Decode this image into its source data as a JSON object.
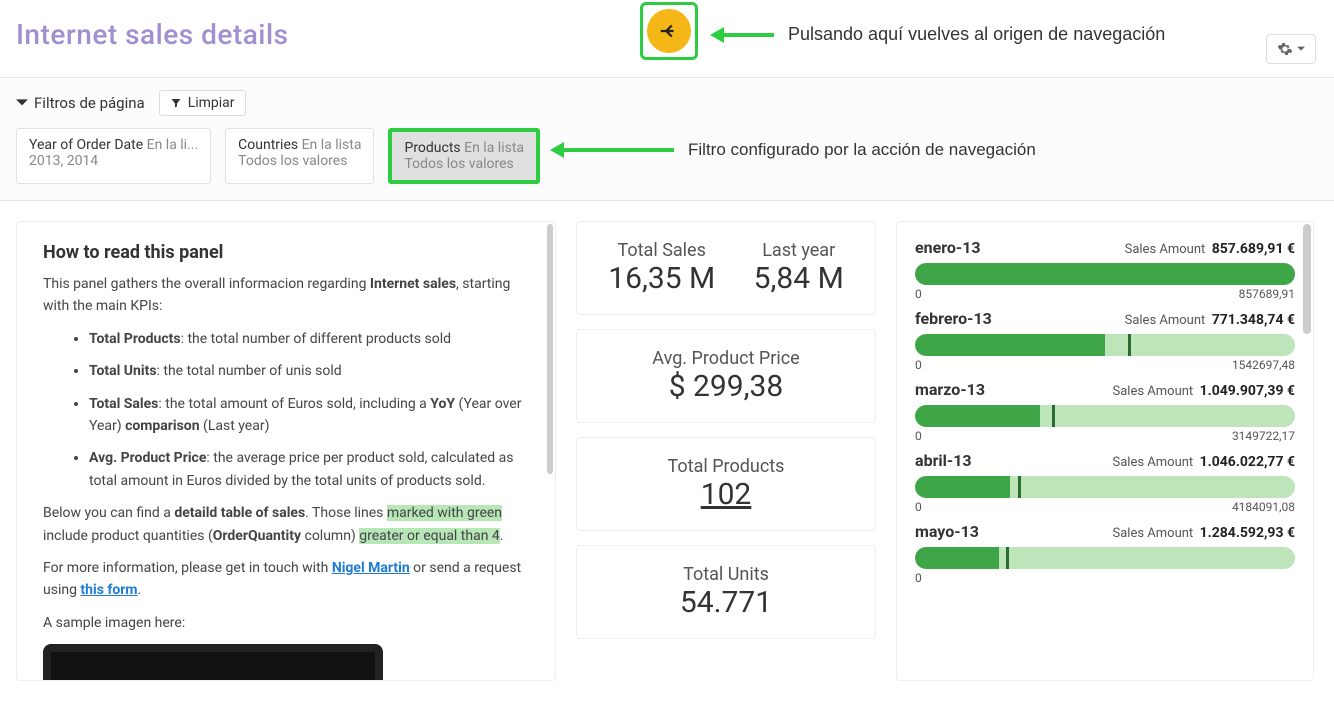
{
  "page_title": "Internet sales details",
  "annotations": {
    "back": "Pulsando aquí vuelves al origen de navegación",
    "filter": "Filtro configurado por la acción de navegación"
  },
  "filters": {
    "head": "Filtros de página",
    "clear": "Limpiar",
    "chips": [
      {
        "label": "Year of Order Date",
        "op": "En la li...",
        "val": "2013, 2014"
      },
      {
        "label": "Countries",
        "op": "En la lista",
        "val": "Todos los valores"
      },
      {
        "label": "Products",
        "op": "En la lista",
        "val": "Todos los valores"
      }
    ]
  },
  "help": {
    "title": "How to read this panel",
    "p1_a": "This panel gathers the overall informacion regarding ",
    "p1_b": "Internet sales",
    "p1_c": ", starting with the main KPIs:",
    "li1_a": "Total Products",
    "li1_b": ": the total number of different products sold",
    "li2_a": "Total Units",
    "li2_b": ": the total number of unis sold",
    "li3_a": "Total Sales",
    "li3_b": ": the total amount of Euros sold, including a ",
    "li3_c": "YoY",
    "li3_d": " (Year over Year) ",
    "li3_e": "comparison",
    "li3_f": " (Last year)",
    "li4_a": "Avg. Product Price",
    "li4_b": ": the average price per product sold, calculated as total amount in Euros divided by the total units of products sold.",
    "p2_a": "Below you can find a ",
    "p2_b": "detaild table of sales",
    "p2_c": ". Those lines ",
    "p2_d": "marked with green",
    "p2_e": " include product quantities (",
    "p2_f": "OrderQuantity",
    "p2_g": " column) ",
    "p2_h": "greater or equal than 4",
    "p2_i": ".",
    "p3_a": "For more information, please get in touch with ",
    "p3_b": "Nigel Martin",
    "p3_c": " or send a request using ",
    "p3_d": "this form",
    "p3_e": ".",
    "p4": "A sample imagen here:"
  },
  "kpis": {
    "total_sales_label": "Total Sales",
    "total_sales_value": "16,35 M",
    "last_year_label": "Last year",
    "last_year_value": "5,84 M",
    "avg_label": "Avg. Product Price",
    "avg_value": "$ 299,38",
    "products_label": "Total Products",
    "products_value": "102",
    "units_label": "Total Units",
    "units_value": "54.771"
  },
  "bars_meta": {
    "metric_label": "Sales Amount",
    "zero": "0"
  },
  "bars": [
    {
      "month": "enero-13",
      "amount": "857.689,91 €",
      "max": "857689,91",
      "fill": 100,
      "target": null
    },
    {
      "month": "febrero-13",
      "amount": "771.348,74 €",
      "max": "1542697,48",
      "fill": 50,
      "target": 56
    },
    {
      "month": "marzo-13",
      "amount": "1.049.907,39 €",
      "max": "3149722,17",
      "fill": 33,
      "target": 36
    },
    {
      "month": "abril-13",
      "amount": "1.046.022,77 €",
      "max": "4184091,08",
      "fill": 25,
      "target": 27
    },
    {
      "month": "mayo-13",
      "amount": "1.284.592,93 €",
      "max": "",
      "fill": 22,
      "target": 24
    }
  ],
  "chart_data": {
    "type": "bar",
    "title": "Monthly Sales Amount",
    "metric": "Sales Amount (€)",
    "series": [
      {
        "month": "enero-13",
        "sales_amount": 857689.91,
        "range_max": 857689.91
      },
      {
        "month": "febrero-13",
        "sales_amount": 771348.74,
        "range_max": 1542697.48
      },
      {
        "month": "marzo-13",
        "sales_amount": 1049907.39,
        "range_max": 3149722.17
      },
      {
        "month": "abril-13",
        "sales_amount": 1046022.77,
        "range_max": 4184091.08
      },
      {
        "month": "mayo-13",
        "sales_amount": 1284592.93,
        "range_max": null
      }
    ]
  }
}
